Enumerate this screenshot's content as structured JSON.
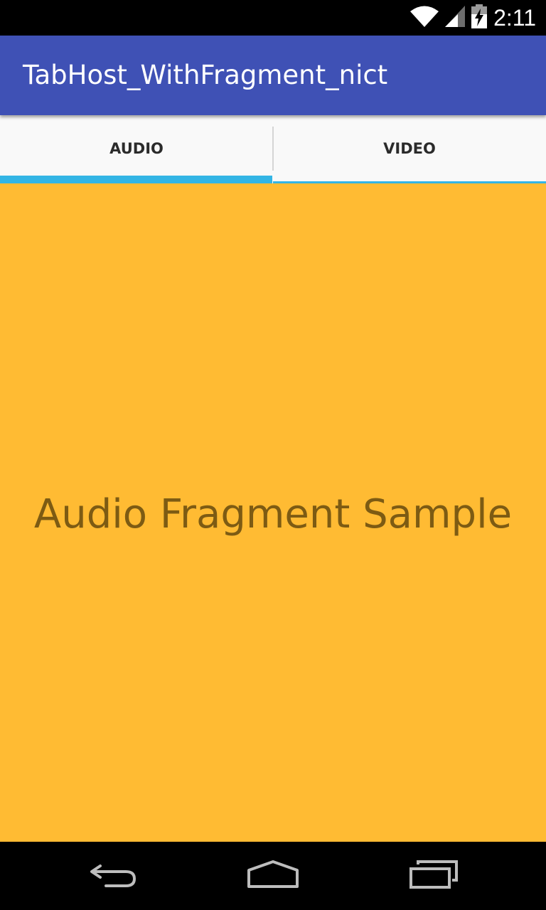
{
  "status_bar": {
    "time": "2:11",
    "icons": [
      "wifi-icon",
      "signal-icon",
      "battery-charging-icon"
    ]
  },
  "app_bar": {
    "title": "TabHost_WithFragment_nict"
  },
  "tabs": [
    {
      "label": "AUDIO",
      "selected": true
    },
    {
      "label": "VIDEO",
      "selected": false
    }
  ],
  "content": {
    "text": "Audio Fragment Sample",
    "background": "#ffbb33"
  },
  "nav_bar": {
    "buttons": [
      "back-icon",
      "home-icon",
      "recent-apps-icon"
    ]
  },
  "colors": {
    "primary": "#3f51b5",
    "tab_indicator": "#33b5e5",
    "content_background": "#ffbb33"
  }
}
